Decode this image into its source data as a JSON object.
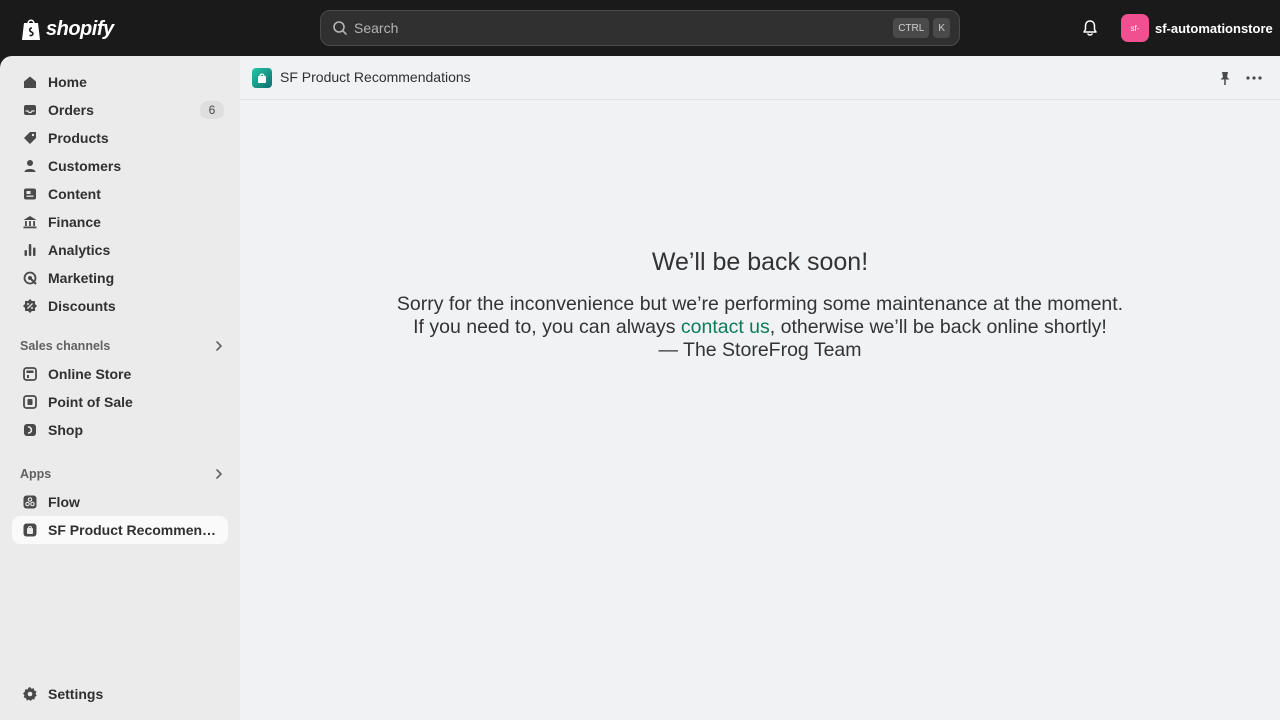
{
  "topbar": {
    "logo_text": "shopify",
    "search_placeholder": "Search",
    "shortcut_keys": [
      "CTRL",
      "K"
    ],
    "store_avatar_text": "sf-",
    "store_name": "sf-automationstore",
    "avatar_color": "#f0508f"
  },
  "sidebar": {
    "items": [
      {
        "label": "Home",
        "icon": "home-icon"
      },
      {
        "label": "Orders",
        "icon": "inbox-icon",
        "badge": "6"
      },
      {
        "label": "Products",
        "icon": "tag-icon"
      },
      {
        "label": "Customers",
        "icon": "person-icon"
      },
      {
        "label": "Content",
        "icon": "content-icon"
      },
      {
        "label": "Finance",
        "icon": "bank-icon"
      },
      {
        "label": "Analytics",
        "icon": "bar-chart-icon"
      },
      {
        "label": "Marketing",
        "icon": "target-icon"
      },
      {
        "label": "Discounts",
        "icon": "discount-icon"
      }
    ],
    "sales_channels_label": "Sales channels",
    "sales_channels": [
      {
        "label": "Online Store",
        "icon": "storefront-icon"
      },
      {
        "label": "Point of Sale",
        "icon": "pos-icon"
      },
      {
        "label": "Shop",
        "icon": "shop-icon"
      }
    ],
    "apps_label": "Apps",
    "apps": [
      {
        "label": "Flow",
        "icon": "flow-icon"
      },
      {
        "label": "SF Product Recommendations",
        "icon": "app-icon"
      }
    ],
    "settings_label": "Settings"
  },
  "app_header": {
    "title": "SF Product Recommendations"
  },
  "maintenance": {
    "headline": "We’ll be back soon!",
    "line1": "Sorry for the inconvenience but we’re performing some maintenance at the moment.",
    "line2_before": "If you need to, you can always ",
    "link_text": "contact us",
    "line2_after": ", otherwise we’ll be back online shortly!",
    "signature": "— The StoreFrog Team",
    "link_color": "#0a7c59"
  }
}
